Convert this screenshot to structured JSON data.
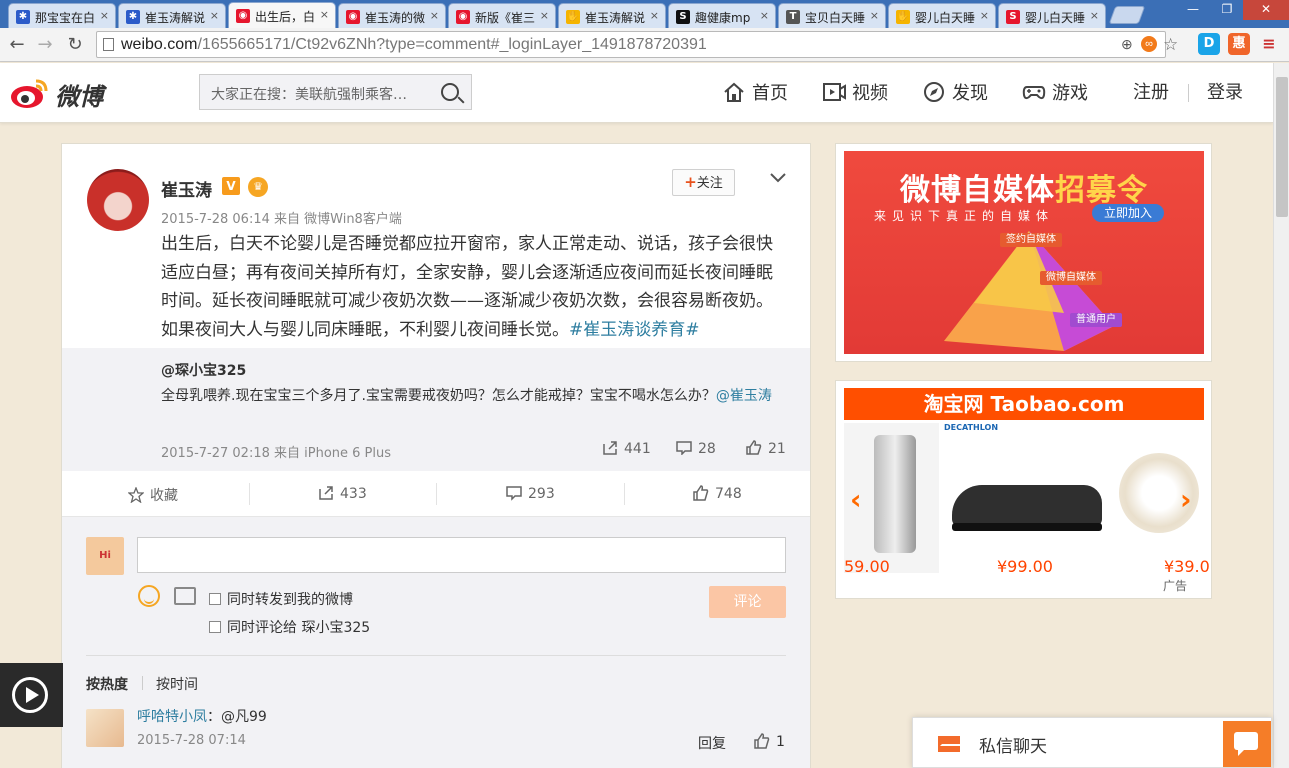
{
  "browser": {
    "tabs": [
      {
        "title": "那宝宝在白",
        "fav": "paw",
        "color": "#2b5bc9"
      },
      {
        "title": "崔玉涛解说",
        "fav": "paw",
        "color": "#2b5bc9"
      },
      {
        "title": "出生后，白",
        "fav": "weibo",
        "color": "#e6162d"
      },
      {
        "title": "崔玉涛的微",
        "fav": "weibo",
        "color": "#e6162d"
      },
      {
        "title": "新版《崔三",
        "fav": "weibo",
        "color": "#e6162d"
      },
      {
        "title": "崔玉涛解说",
        "fav": "hand",
        "color": "#f5b400"
      },
      {
        "title": "趣健康mp",
        "fav": "S",
        "color": "#111"
      },
      {
        "title": "宝贝白天睡",
        "fav": "T",
        "color": "#555"
      },
      {
        "title": "婴儿白天睡",
        "fav": "hand",
        "color": "#f5b400"
      },
      {
        "title": "婴儿白天睡",
        "fav": "S",
        "color": "#e6162d"
      }
    ],
    "active_tab": 2,
    "url_domain": "weibo.com",
    "url_path": "/1655665171/Ct92v6ZNh?type=comment#_loginLayer_1491878720391"
  },
  "header": {
    "logo_text": "微博",
    "search_placeholder": "大家正在搜：美联航强制乘客…",
    "nav": [
      "首页",
      "视频",
      "发现",
      "游戏"
    ],
    "register": "注册",
    "login": "登录"
  },
  "post": {
    "username": "崔玉涛",
    "vbadge": "V",
    "follow_label": "关注",
    "meta": "2015-7-28 06:14 来自 微博Win8客户端",
    "text": "出生后，白天不论婴儿是否睡觉都应拉开窗帘，家人正常走动、说话，孩子会很快适应白昼；再有夜间关掉所有灯，全家安静，婴儿会逐渐适应夜间而延长夜间睡眠时间。延长夜间睡眠就可减少夜奶次数——逐渐减少夜奶次数，会很容易断夜奶。如果夜间大人与婴儿同床睡眠，不利婴儿夜间睡长觉。",
    "topic": "#崔玉涛谈养育#",
    "repost": {
      "user": "@琛小宝325",
      "text": "全母乳喂养.现在宝宝三个多月了.宝宝需要戒夜奶吗？怎么才能戒掉？宝宝不喝水怎么办？",
      "mention": "@崔玉涛",
      "meta": "2015-7-27 02:18 来自 iPhone 6 Plus",
      "forward": "441",
      "comment": "28",
      "like": "21"
    },
    "actions": {
      "favorite": "收藏",
      "forward": "433",
      "comment": "293",
      "like": "748"
    }
  },
  "comment_box": {
    "check1": "同时转发到我的微博",
    "check2": "同时评论给 琛小宝325",
    "submit": "评论",
    "sort_hot": "按热度",
    "sort_time": "按时间"
  },
  "comments": [
    {
      "name": "呼哈特小凤",
      "text": "：@凡99",
      "time": "2015-7-28 07:14",
      "reply": "回复",
      "likes": "1"
    }
  ],
  "sidebar": {
    "ad1": {
      "title_a": "微博自媒体",
      "title_b": "招募令",
      "sub": "来见识下真正的自媒体",
      "join": "立即加入",
      "levels": [
        "签约自媒体",
        "微博自媒体",
        "普通用户"
      ]
    },
    "ad2": {
      "head": "淘宝网 Taobao.com",
      "prices": [
        "59.00",
        "¥99.00",
        "¥39.0"
      ],
      "brand": "DECATHLON",
      "adtag": "广告"
    }
  },
  "chat": {
    "label": "私信聊天"
  }
}
